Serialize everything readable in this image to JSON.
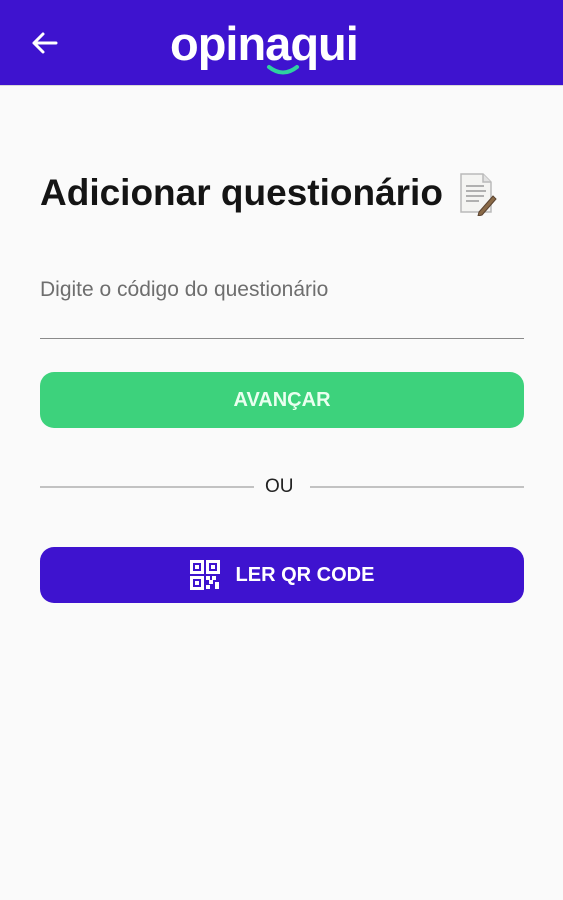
{
  "app": {
    "brand": "opinaqui"
  },
  "page": {
    "title": "Adicionar questionário"
  },
  "form": {
    "code_placeholder": "Digite o código do questionário",
    "code_value": ""
  },
  "actions": {
    "next_label": "AVANÇAR",
    "qr_label": "LER QR CODE"
  },
  "divider": {
    "text": "OU"
  },
  "icons": {
    "back": "arrow-left-icon",
    "title": "document-with-pen-icon",
    "qr": "qr-code-icon"
  },
  "colors": {
    "primary": "#3e13cf",
    "accent_green": "#3dd27c",
    "background": "#fafafa",
    "logo_smile": "#2fd1a0"
  }
}
